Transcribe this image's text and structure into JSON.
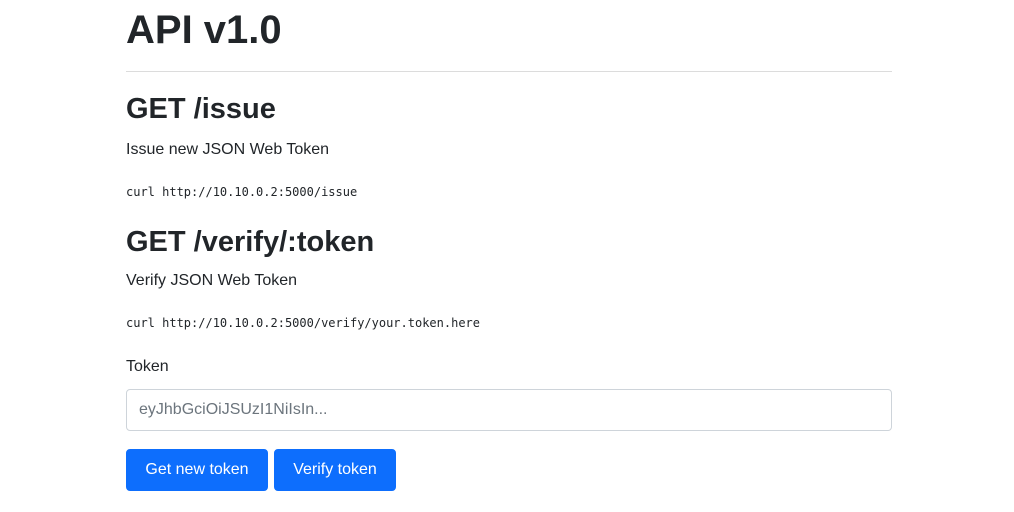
{
  "page": {
    "title": "API v1.0"
  },
  "endpoints": [
    {
      "title": "GET /issue",
      "description": "Issue new JSON Web Token",
      "example": "curl http://10.10.0.2:5000/issue"
    },
    {
      "title": "GET /verify/:token",
      "description": "Verify JSON Web Token",
      "example": "curl http://10.10.0.2:5000/verify/your.token.here"
    }
  ],
  "token_form": {
    "label": "Token",
    "value": "",
    "placeholder": "eyJhbGciOiJSUzI1NiIsIn...",
    "get_button_label": "Get new token",
    "verify_button_label": "Verify token"
  },
  "colors": {
    "primary": "#0d6efd",
    "text": "#212529",
    "divider": "#dcdcdc"
  }
}
